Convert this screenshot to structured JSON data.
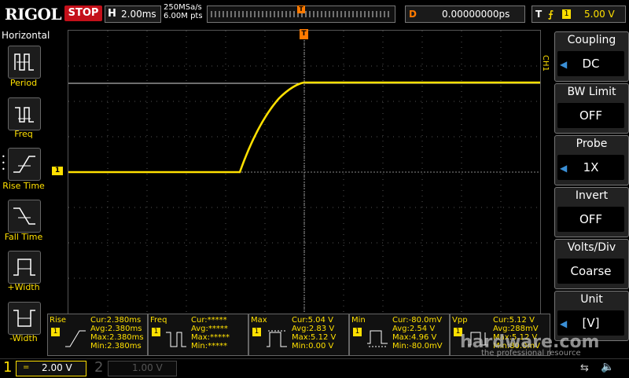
{
  "top": {
    "logo": "RIGOL",
    "run_state": "STOP",
    "horizontal_label": "H",
    "timebase": "2.00ms",
    "sample_rate": "250MSa/s",
    "memory_depth": "6.00M pts",
    "trigger_pos_marker": "T",
    "delay_label": "D",
    "delay_value": "0.00000000ps",
    "trigger_label": "T",
    "trigger_edge": "⨍",
    "trigger_source": "1",
    "trigger_level": "5.00 V"
  },
  "left_panel": {
    "title": "Horizontal",
    "items": [
      {
        "label": "Period"
      },
      {
        "label": "Freq"
      },
      {
        "label": "Rise Time"
      },
      {
        "label": "Fall Time"
      },
      {
        "label": "+Width"
      },
      {
        "label": "-Width"
      }
    ]
  },
  "screen": {
    "trigger_marker": "T",
    "channel_marker": "1",
    "trace_color": "#ffe000",
    "trigger_color": "#ff7a00"
  },
  "right_panel": {
    "channel_tag": "CH1",
    "items": [
      {
        "title": "Coupling",
        "value": "DC"
      },
      {
        "title": "BW Limit",
        "value": "OFF"
      },
      {
        "title": "Probe",
        "value": "1X"
      },
      {
        "title": "Invert",
        "value": "OFF"
      },
      {
        "title": "Volts/Div",
        "value": "Coarse"
      },
      {
        "title": "Unit",
        "value": "[V]"
      }
    ]
  },
  "measurements": [
    {
      "name": "Rise",
      "source": "1",
      "cur": "Cur:2.380ms",
      "avg": "Avg:2.380ms",
      "max": "Max:2.380ms",
      "min": "Min:2.380ms"
    },
    {
      "name": "Freq",
      "source": "1",
      "cur": "Cur:*****",
      "avg": "Avg:*****",
      "max": "Max:*****",
      "min": "Min:*****"
    },
    {
      "name": "Max",
      "source": "1",
      "cur": "Cur:5.04 V",
      "avg": "Avg:2.83 V",
      "max": "Max:5.12 V",
      "min": "Min:0.00 V"
    },
    {
      "name": "Min",
      "source": "1",
      "cur": "Cur:-80.0mV",
      "avg": "Avg:2.54 V",
      "max": "Max:4.96 V",
      "min": "Min:-80.0mV"
    },
    {
      "name": "Vpp",
      "source": "1",
      "cur": "Cur:5.12 V",
      "avg": "Avg:288mV",
      "max": "Max:5.12 V",
      "min": "Min:80.0mV"
    }
  ],
  "watermark": {
    "main": "hardware.com",
    "sub": "the professional resource"
  },
  "bottom": {
    "ch1_number": "1",
    "ch1_coupling": "=",
    "ch1_scale": "2.00 V",
    "ch2_number": "2",
    "ch2_scale": "1.00 V",
    "usb_icon": "⇆",
    "speaker_icon": "🔈"
  }
}
